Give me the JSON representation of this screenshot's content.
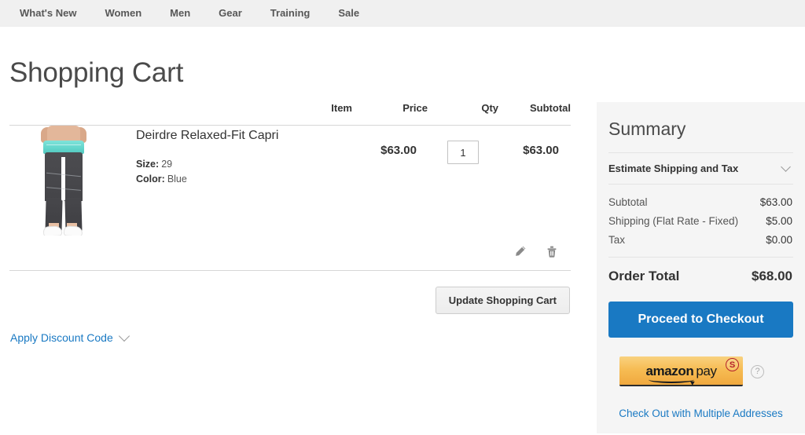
{
  "nav": {
    "items": [
      {
        "label": "What's New",
        "name": "nav-item-whats-new"
      },
      {
        "label": "Women",
        "name": "nav-item-women"
      },
      {
        "label": "Men",
        "name": "nav-item-men"
      },
      {
        "label": "Gear",
        "name": "nav-item-gear"
      },
      {
        "label": "Training",
        "name": "nav-item-training"
      },
      {
        "label": "Sale",
        "name": "nav-item-sale"
      }
    ]
  },
  "page": {
    "title": "Shopping Cart"
  },
  "cart": {
    "headers": {
      "item": "Item",
      "price": "Price",
      "qty": "Qty",
      "subtotal": "Subtotal"
    },
    "items": [
      {
        "name": "Deirdre Relaxed-Fit Capri",
        "image_alt": "Deirdre Relaxed-Fit Capri product thumbnail",
        "options": [
          {
            "label": "Size:",
            "value": "29"
          },
          {
            "label": "Color:",
            "value": "Blue"
          }
        ],
        "price": "$63.00",
        "qty": "1",
        "subtotal": "$63.00",
        "edit_icon": "pencil-icon",
        "delete_icon": "trash-icon"
      }
    ],
    "update_button": "Update Shopping Cart",
    "discount_label": "Apply Discount Code",
    "discount_icon": "chevron-down-icon"
  },
  "summary": {
    "title": "Summary",
    "estimate_label": "Estimate Shipping and Tax",
    "estimate_icon": "chevron-down-icon",
    "rows": [
      {
        "label": "Subtotal",
        "value": "$63.00"
      },
      {
        "label": "Shipping (Flat Rate - Fixed)",
        "value": "$5.00"
      },
      {
        "label": "Tax",
        "value": "$0.00"
      }
    ],
    "order_total_label": "Order Total",
    "order_total_value": "$68.00",
    "checkout_button": "Proceed to Checkout",
    "amazon_pay": {
      "brand": "amazon",
      "pay": "pay",
      "badge": "S",
      "help_icon": "help-circle-icon"
    },
    "multiple_addresses_link": "Check Out with Multiple Addresses"
  },
  "colors": {
    "accent_blue": "#1979c3",
    "link_blue": "#1979c3",
    "summary_bg": "#f5f5f5",
    "nav_bg": "#f0f0f0",
    "amazon_orange": "#f6bb52"
  }
}
